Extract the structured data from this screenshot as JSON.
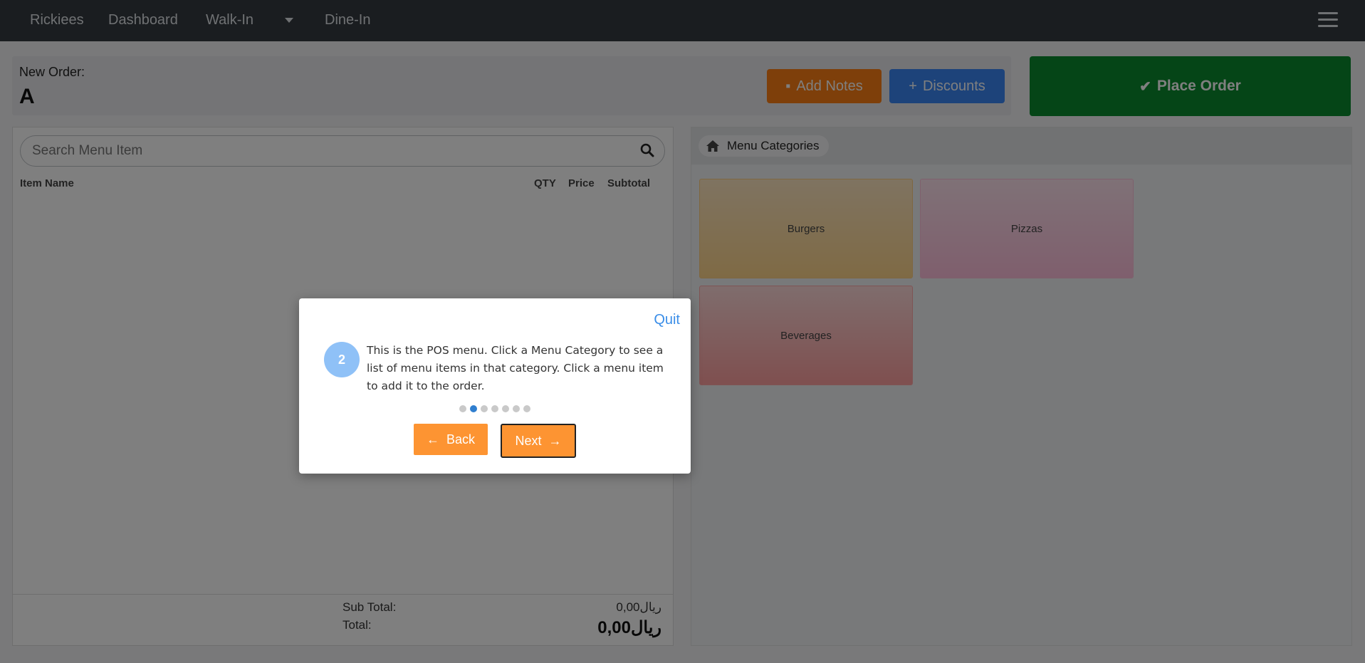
{
  "navbar": {
    "brand": "Rickiees",
    "links": [
      "Dashboard",
      "Walk-In",
      "Dine-In"
    ]
  },
  "order": {
    "label": "New Order:",
    "name": "A",
    "add_notes": "Add Notes",
    "discounts": "Discounts",
    "place_order": "Place Order"
  },
  "search": {
    "placeholder": "Search Menu Item"
  },
  "table": {
    "columns": [
      "Item Name",
      "QTY",
      "Price",
      "Subtotal"
    ]
  },
  "totals": {
    "subtotal_label": "Sub Total:",
    "subtotal_value": "0,00ريال",
    "total_label": "Total:",
    "total_value": "0,00ريال"
  },
  "menu": {
    "breadcrumb": "Menu Categories",
    "categories": [
      "Burgers",
      "Pizzas",
      "Beverages"
    ]
  },
  "tour": {
    "quit": "Quit",
    "step": "2",
    "text": "This is the POS menu. Click a Menu Category to see a list of menu items in that category. Click a menu item to add it to the order.",
    "total_steps": 7,
    "current_step": 2,
    "back": "Back",
    "next": "Next"
  },
  "colors": {
    "primary_orange": "#fd7e14",
    "discount_blue": "#3b86f5",
    "place_green": "#0b8b2e"
  }
}
